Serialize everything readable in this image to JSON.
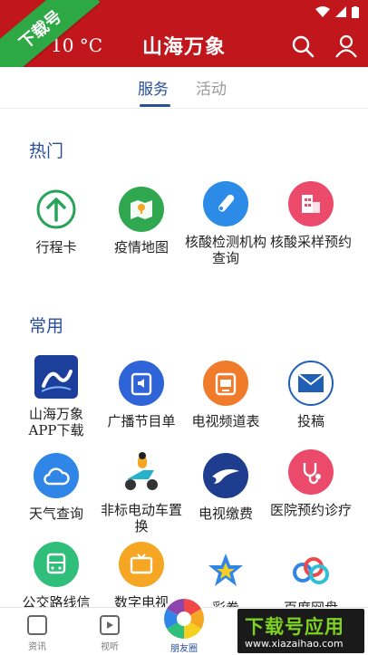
{
  "header": {
    "temperature": "10 °C",
    "title": "山海万象"
  },
  "watermark_ribbon": "下载号",
  "tabs": [
    {
      "label": "服务"
    },
    {
      "label": "活动"
    }
  ],
  "sections": {
    "hot": {
      "title": "热门",
      "items": [
        {
          "label": "行程卡",
          "icon": "itinerary-arrow-icon"
        },
        {
          "label": "疫情地图",
          "icon": "epidemic-map-icon"
        },
        {
          "label": "核酸检测机构查询",
          "icon": "test-tube-icon"
        },
        {
          "label": "核酸采样预约",
          "icon": "building-icon"
        }
      ]
    },
    "common": {
      "title": "常用",
      "items": [
        {
          "label": "山海万象APP下载",
          "icon": "app-logo-icon"
        },
        {
          "label": "广播节目单",
          "icon": "radio-schedule-icon"
        },
        {
          "label": "电视频道表",
          "icon": "tv-schedule-icon"
        },
        {
          "label": "投稿",
          "icon": "mail-icon"
        },
        {
          "label": "天气查询",
          "icon": "cloud-icon"
        },
        {
          "label": "非标电动车置换",
          "icon": "scooter-icon"
        },
        {
          "label": "电视缴费",
          "icon": "bird-icon"
        },
        {
          "label": "医院预约诊疗",
          "icon": "stethoscope-icon"
        },
        {
          "label": "公交路线信",
          "icon": "bus-icon"
        },
        {
          "label": "数字电视",
          "icon": "digital-tv-icon"
        },
        {
          "label": "彩卷",
          "icon": "star-icon"
        },
        {
          "label": "百度网盘",
          "icon": "cloud-drive-icon"
        }
      ]
    }
  },
  "bottom_nav": [
    {
      "label": "资讯",
      "icon": "news-icon"
    },
    {
      "label": "视听",
      "icon": "play-icon"
    },
    {
      "label": "朋友圈",
      "icon": "aperture-icon"
    }
  ],
  "watermark": {
    "main": "下载号应用",
    "url": "www.xiazaihao.com"
  },
  "colors": {
    "brand_red": "#c0161c",
    "accent_blue": "#2a4f9a"
  }
}
